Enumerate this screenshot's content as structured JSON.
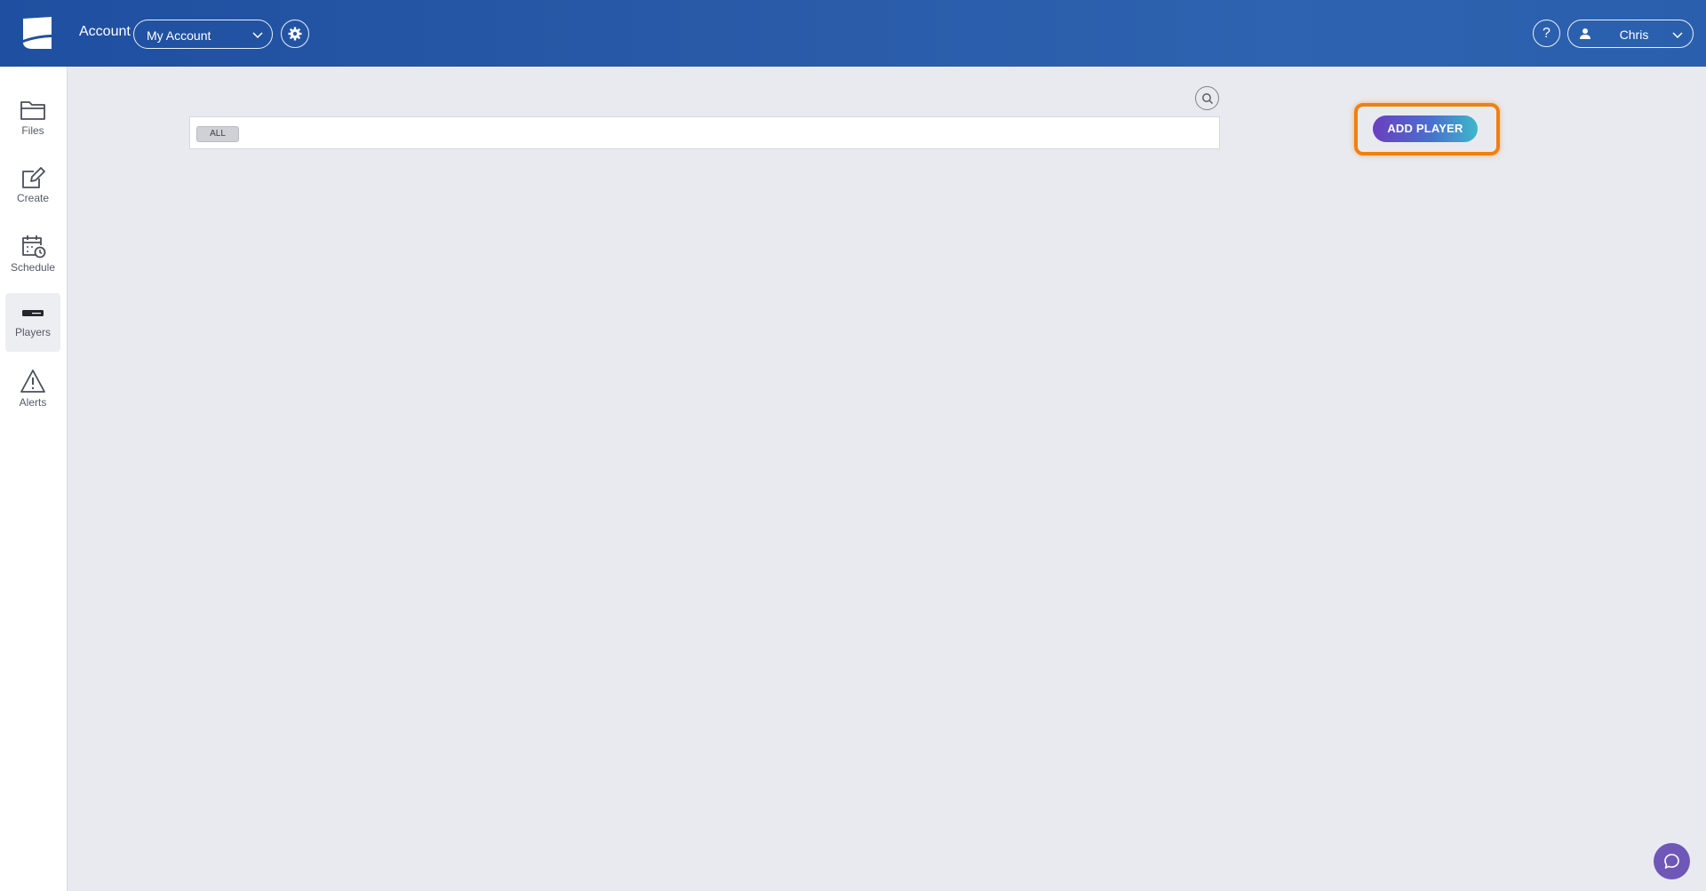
{
  "header": {
    "account_label": "Account",
    "account_select_value": "My Account",
    "help_label": "?",
    "user_name": "Chris",
    "colors": {
      "bar": "#2a5caa",
      "text": "#ffffff"
    }
  },
  "sidebar": {
    "items": [
      {
        "label": "Files",
        "icon": "folder-icon",
        "active": false
      },
      {
        "label": "Create",
        "icon": "edit-icon",
        "active": false
      },
      {
        "label": "Schedule",
        "icon": "calendar-clock-icon",
        "active": false
      },
      {
        "label": "Players",
        "icon": "player-device-icon",
        "active": true
      },
      {
        "label": "Alerts",
        "icon": "warning-icon",
        "active": false
      }
    ]
  },
  "main": {
    "filter_chip": "ALL",
    "add_player_label": "ADD PLAYER",
    "highlight_color": "#f0800f"
  }
}
